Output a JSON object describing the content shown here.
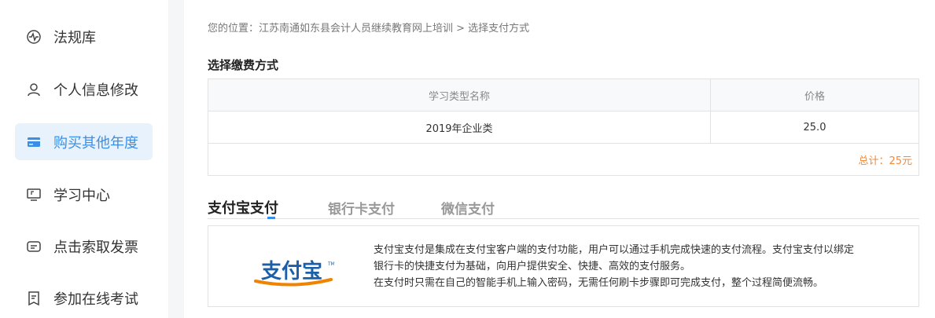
{
  "sidebar": {
    "items": [
      {
        "label": "法规库",
        "icon": "pulse-icon"
      },
      {
        "label": "个人信息修改",
        "icon": "user-icon"
      },
      {
        "label": "购买其他年度",
        "icon": "card-icon",
        "active": true
      },
      {
        "label": "学习中心",
        "icon": "monitor-icon"
      },
      {
        "label": "点击索取发票",
        "icon": "message-icon"
      },
      {
        "label": "参加在线考试",
        "icon": "document-icon"
      }
    ]
  },
  "breadcrumb": {
    "text": "您的位置：江苏南通如东县会计人员继续教育网上培训 > 选择支付方式"
  },
  "fee": {
    "title": "选择缴费方式",
    "columns": [
      "学习类型名称",
      "价格"
    ],
    "rows": [
      {
        "name": "2019年企业类",
        "price": "25.0"
      }
    ],
    "total": "总计：25元"
  },
  "payment": {
    "tabs": [
      "支付宝支付",
      "银行卡支付",
      "微信支付"
    ],
    "active_tab": 0,
    "logo_text": "支付宝",
    "description": [
      "支付宝支付是集成在支付宝客户端的支付功能，用户可以通过手机完成快速的支付流程。支付宝支付以绑定",
      "银行卡的快捷支付为基础，向用户提供安全、快捷、高效的支付服务。",
      "在支付时只需在自己的智能手机上输入密码，无需任何刷卡步骤即可完成支付，整个过程简便流畅。"
    ]
  },
  "colors": {
    "accent": "#3a8ee6",
    "active_bg": "#e8f2fd",
    "total": "#f08a3c",
    "logo_blue": "#1a5fa8",
    "logo_orange": "#f08300"
  }
}
